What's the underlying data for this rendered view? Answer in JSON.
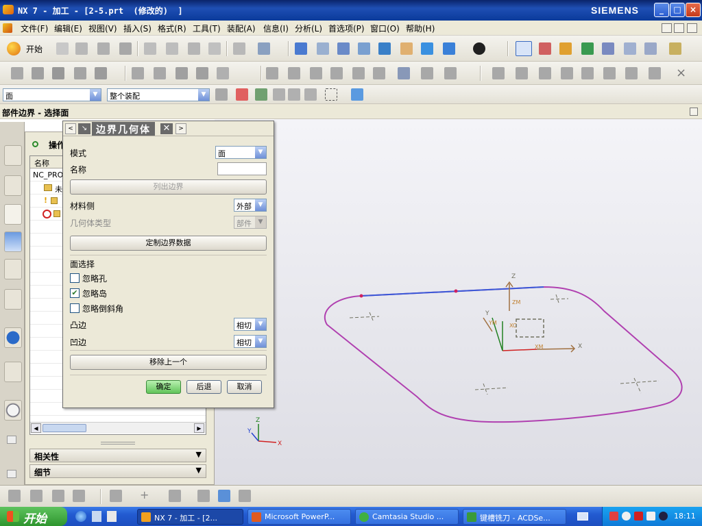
{
  "window": {
    "title": "NX 7 - 加工 - [2-5.prt  (修改的)  ]",
    "brand": "SIEMENS",
    "controls": {
      "minimize": "_",
      "maximize": "□",
      "close": "×"
    }
  },
  "menu": {
    "items": [
      "文件(F)",
      "编辑(E)",
      "视图(V)",
      "插入(S)",
      "格式(R)",
      "工具(T)",
      "装配(A)",
      "信息(I)",
      "分析(L)",
      "首选项(P)",
      "窗口(O)",
      "帮助(H)"
    ]
  },
  "toolbar": {
    "start_label": "开始",
    "select_filter": "面",
    "assembly_scope": "整个装配"
  },
  "cue_line": "部件边界 - 选择面",
  "navigator": {
    "title": "操作",
    "column_name": "名称",
    "rows": [
      "NC_PRO",
      "未",
      "",
      ""
    ],
    "dependencies_label": "相关性",
    "details_label": "细节"
  },
  "dialog": {
    "title": "边界几何体",
    "mode_label": "模式",
    "mode_value": "面",
    "name_label": "名称",
    "name_value": "",
    "list_boundary_button": "列出边界",
    "material_side_label": "材料侧",
    "material_side_value": "外部",
    "geometry_type_label": "几何体类型",
    "geometry_type_value": "部件",
    "custom_data_button": "定制边界数据",
    "face_selection_label": "面选择",
    "ignore_holes_label": "忽略孔",
    "ignore_holes_checked": false,
    "ignore_islands_label": "忽略岛",
    "ignore_islands_checked": true,
    "ignore_chamfers_label": "忽略倒斜角",
    "ignore_chamfers_checked": false,
    "convex_edge_label": "凸边",
    "convex_edge_value": "相切",
    "concave_edge_label": "凹边",
    "concave_edge_value": "相切",
    "remove_last_button": "移除上一个",
    "ok_button": "确定",
    "back_button": "后退",
    "cancel_button": "取消"
  },
  "viewport": {
    "axis_labels": {
      "x": "X",
      "y": "Y",
      "z": "Z"
    },
    "wcs_labels": {
      "xm": "XM",
      "ym": "YM",
      "zm": "ZM",
      "xc": "XC"
    },
    "boundary_color": "#b040b0",
    "selected_edge_color": "#3a5ad8"
  },
  "taskbar": {
    "start": "开始",
    "tasks": [
      "NX 7 - 加工 - [2...",
      "Microsoft PowerP...",
      "Camtasia Studio ...",
      "键槽铣刀 - ACDSe..."
    ],
    "clock": "18:11"
  }
}
